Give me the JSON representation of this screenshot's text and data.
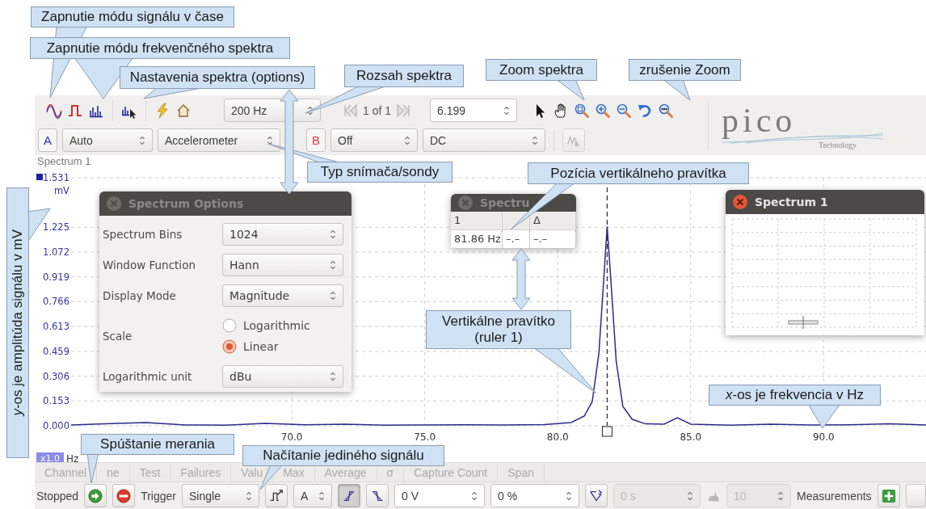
{
  "toolbar": {
    "spectrum_range": "200 Hz",
    "page": "1 of 1",
    "zoom_value": "6.199"
  },
  "logo": {
    "name": "pico",
    "tagline": "Technology"
  },
  "channels": [
    {
      "letter": "A",
      "color": "#2c2cc8",
      "range": "Auto",
      "probe": "Accelerometer"
    },
    {
      "letter": "B",
      "color": "#d83a3a",
      "range": "Off",
      "coupling": "DC"
    }
  ],
  "chart": {
    "title": "Spectrum 1",
    "y_unit": "mV",
    "x_unit": "Hz",
    "zoom_badge": "x1.0",
    "chart_data": {
      "type": "line",
      "x": [
        61.7,
        63,
        64.5,
        66,
        67.5,
        69,
        70.5,
        72,
        73.5,
        75,
        76.5,
        78,
        79.5,
        80.5,
        81,
        81.3,
        81.55,
        81.75,
        81.86,
        82,
        82.2,
        82.45,
        82.8,
        83.3,
        84,
        84.5,
        85,
        86.5,
        88,
        89.5,
        91,
        92.5,
        93.85
      ],
      "series": [
        {
          "color": "#2b2b8c",
          "values": [
            0.005,
            0.012,
            0.02,
            0.005,
            0.004,
            0.015,
            0.006,
            0.01,
            0.004,
            0.005,
            0.006,
            0.005,
            0.008,
            0.02,
            0.06,
            0.15,
            0.45,
            0.95,
            1.23,
            0.9,
            0.4,
            0.12,
            0.04,
            0.012,
            0.01,
            0.05,
            0.01,
            0.004,
            0.01,
            0.005,
            0.006,
            0.012,
            0.005
          ]
        }
      ],
      "xlim": [
        61.7,
        93.85
      ],
      "ylim": [
        0,
        1.531
      ],
      "xticks": [
        {
          "value": 70,
          "label": "70.0"
        },
        {
          "value": 75,
          "label": "75.0"
        },
        {
          "value": 80,
          "label": "80.0"
        },
        {
          "value": 85,
          "label": "85.0"
        },
        {
          "value": 90,
          "label": "90.0"
        }
      ],
      "yticks": [
        {
          "value": 0,
          "label": "0.000"
        },
        0.153,
        0.306,
        0.459,
        0.613,
        0.766,
        0.919,
        1.072,
        1.225,
        1.531
      ],
      "grid": true,
      "ref_lines": [
        {
          "axis": "x",
          "value": 81.86
        }
      ]
    }
  },
  "measurement_columns": [
    "Channel",
    "ne",
    "Test",
    "Failures",
    "Valu",
    "Max",
    "Average",
    "σ",
    "Capture Count",
    "Span"
  ],
  "status_bar": {
    "status": "Stopped",
    "trigger_label": "Trigger",
    "trigger_mode": "Single",
    "trigger_channel": "A",
    "edges": [
      {
        "kind": "rising",
        "selected": true
      },
      {
        "kind": "falling",
        "selected": false
      }
    ],
    "threshold": "0 V",
    "pre_trigger": "0 %",
    "delay": {
      "value": "0 s",
      "disabled": true
    },
    "capture_count": {
      "value": "10",
      "disabled": true
    },
    "measurements_label": "Measurements"
  },
  "spectrum_options": {
    "title": "Spectrum Options",
    "active": false,
    "fields": [
      {
        "kind": "select",
        "label": "Spectrum Bins",
        "value": "1024"
      },
      {
        "kind": "select",
        "label": "Window Function",
        "value": "Hann"
      },
      {
        "kind": "select",
        "label": "Display Mode",
        "value": "Magnitude"
      },
      {
        "kind": "radio",
        "label": "Scale",
        "options": [
          {
            "label": "Logarithmic",
            "selected": false
          },
          {
            "label": "Linear",
            "selected": true
          }
        ]
      },
      {
        "kind": "select",
        "label": "Logarithmic unit",
        "value": "dBu"
      }
    ]
  },
  "ruler_window": {
    "title": "Spectru",
    "active": false,
    "columns": [
      {
        "header": "1",
        "value": "81.86 Hz"
      },
      {
        "value": "–.–"
      },
      {
        "header": "Δ",
        "value": "–.–"
      }
    ]
  },
  "preview_window": {
    "title": "Spectrum 1",
    "active": true
  },
  "callouts": [
    {
      "kind": "balloon",
      "text": "Zapnutie módu signálu v čase"
    },
    {
      "kind": "balloon",
      "text": "Zapnutie módu frekvenčného spektra"
    },
    {
      "kind": "balloon",
      "text": "Nastavenia spektra (options)"
    },
    {
      "kind": "balloon",
      "text": "Rozsah spektra"
    },
    {
      "kind": "balloon",
      "text": "Zoom spektra"
    },
    {
      "kind": "balloon",
      "text": "zrušenie Zoom"
    },
    {
      "kind": "balloon",
      "text": "Typ snímača/sondy"
    },
    {
      "kind": "balloon",
      "text": "Pozícia vertikálneho pravítka"
    },
    {
      "kind": "balloon",
      "text": "Vertikálne pravítko (ruler 1)"
    },
    {
      "kind": "balloon",
      "text": "*x*-os je frekvencia v Hz"
    },
    {
      "kind": "balloon",
      "text": "Spúštanie merania"
    },
    {
      "kind": "balloon",
      "text": "Načítanie jediného signálu"
    },
    {
      "kind": "vertical",
      "text": "*y*-os je amplitúda signálu v mV"
    }
  ]
}
